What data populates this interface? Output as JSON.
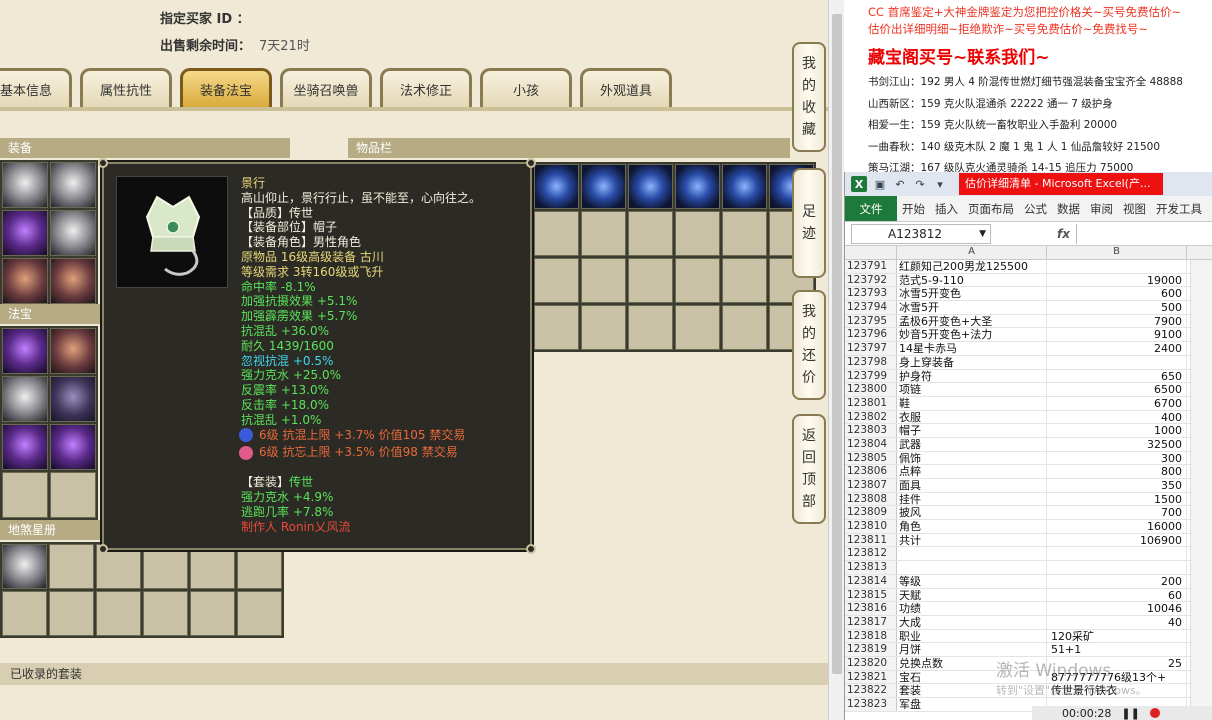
{
  "header": {
    "buyer_label": "指定买家 ID ：",
    "time_label": "出售剩余时间：",
    "time_value": "7天21时"
  },
  "tabs": [
    "基本信息",
    "属性抗性",
    "装备法宝",
    "坐骑召唤兽",
    "法术修正",
    "小孩",
    "外观道具"
  ],
  "active_tab": "装备法宝",
  "sections": {
    "equipment": "装备",
    "items": "物品栏",
    "fabao": "法宝",
    "star": "地煞星册",
    "suits": "已收录的套装"
  },
  "tooltip": {
    "name": "景行",
    "desc": "高山仰止，景行行止，虽不能至，心向往之。",
    "quality": "【品质】传世",
    "slot": "【装备部位】帽子",
    "role": "【装备角色】男性角色",
    "origin": "原物品 16级高级装备 古川",
    "req": "等级需求 3转160级或飞升",
    "stats_yellow": [
      "命中率 -8.1%",
      "加强抗摄效果 +5.1%",
      "加强霹雳效果 +5.7%",
      "抗混乱 +36.0%",
      "耐久 1439/1600"
    ],
    "stats_cyan": [
      "忽视抗混 +0.5%",
      "强力克水 +25.0%",
      "反震率 +13.0%",
      "反击率 +18.0%",
      "抗混乱 +1.0%"
    ],
    "gems": [
      {
        "text": "6级 抗混上限 +3.7% 价值105 禁交易",
        "color": "#3a5ad8"
      },
      {
        "text": "6级 抗忘上限 +3.5% 价值98 禁交易",
        "color": "#e05a8a"
      }
    ],
    "suit_title": "【套装】",
    "suit_name": "传世",
    "suit_stats": [
      "强力克水 +4.9%",
      "逃跑几率 +7.8%"
    ],
    "maker": "制作人 Ronin乂风流"
  },
  "side_buttons": [
    {
      "label": [
        "我",
        "的",
        "收",
        "藏"
      ]
    },
    {
      "label": [
        "足",
        "迹"
      ]
    },
    {
      "label": [
        "我",
        "的",
        "还",
        "价"
      ]
    },
    {
      "label": [
        "返",
        "回",
        "顶",
        "部"
      ]
    }
  ],
  "note": {
    "line1": "CC 首席鉴定+大神金牌鉴定为您把控价格关~买号免费估价~",
    "line2": "估价出详细明细~拒绝欺诈~买号免费估价~免费找号~",
    "big": "藏宝阁买号~联系我们~",
    "rows": [
      "书剑江山：192 男人 4 阶混传世燃灯细节强混装备宝宝齐全 48888",
      "山西新区：159 克火队混通杀 22222 通一 7 级护身",
      "相爱一生：159 克火队统一畜牧职业入手盈利 20000",
      "一曲春秋：140 级克木队 2 魔 1 鬼 1 人 1 仙品詹较好 21500",
      "策马江湖：167 级队克火通灵骑杀 14-15 追压力 75000"
    ]
  },
  "excel": {
    "title": "估价详细清单 - Microsoft Excel(产...",
    "ribbon_file": "文件",
    "ribbon_tabs": [
      "开始",
      "插入",
      "页面布局",
      "公式",
      "数据",
      "审阅",
      "视图",
      "开发工具"
    ],
    "name_box": "A123812",
    "fx": "fx",
    "col_a": "A",
    "col_b": "B",
    "rows": [
      [
        "123791",
        "红颜知己200男龙125500",
        ""
      ],
      [
        "123792",
        "范式5-9-110",
        "19000"
      ],
      [
        "123793",
        "冰雪5开变色",
        "600"
      ],
      [
        "123794",
        "冰雪5开",
        "500"
      ],
      [
        "123795",
        "孟极6开变色+大圣",
        "7900"
      ],
      [
        "123796",
        "妙音5开变色+法力",
        "9100"
      ],
      [
        "123797",
        "14星卡赤马",
        "2400"
      ],
      [
        "123798",
        "身上穿装备",
        ""
      ],
      [
        "123799",
        "护身符",
        "650"
      ],
      [
        "123800",
        "项链",
        "6500"
      ],
      [
        "123801",
        "鞋",
        "6700"
      ],
      [
        "123802",
        "衣服",
        "400"
      ],
      [
        "123803",
        "帽子",
        "1000"
      ],
      [
        "123804",
        "武器",
        "32500"
      ],
      [
        "123805",
        "佩饰",
        "300"
      ],
      [
        "123806",
        "点粹",
        "800"
      ],
      [
        "123807",
        "面具",
        "350"
      ],
      [
        "123808",
        "挂件",
        "1500"
      ],
      [
        "123809",
        "披风",
        "700"
      ],
      [
        "123810",
        "角色",
        "16000"
      ],
      [
        "123811",
        "共计",
        "106900"
      ],
      [
        "123812",
        "",
        ""
      ],
      [
        "123813",
        "",
        ""
      ],
      [
        "123814",
        "等级",
        "200"
      ],
      [
        "123815",
        "天赋",
        "60"
      ],
      [
        "123816",
        "功绩",
        "10046"
      ],
      [
        "123817",
        "大成",
        "40"
      ],
      [
        "123818",
        "职业",
        "120采矿"
      ],
      [
        "123819",
        "月饼",
        "51+1"
      ],
      [
        "123820",
        "兑换点数",
        "25"
      ],
      [
        "123821",
        "宝石",
        "8777777776级13个+"
      ],
      [
        "123822",
        "套装",
        "传世景行铁衣"
      ],
      [
        "123823",
        "军盘",
        ""
      ]
    ]
  },
  "watermark": "激活 Windows",
  "watermark_sub": "转到\"设置\"以激活 Windows。",
  "recorder_time": "00:00:28"
}
